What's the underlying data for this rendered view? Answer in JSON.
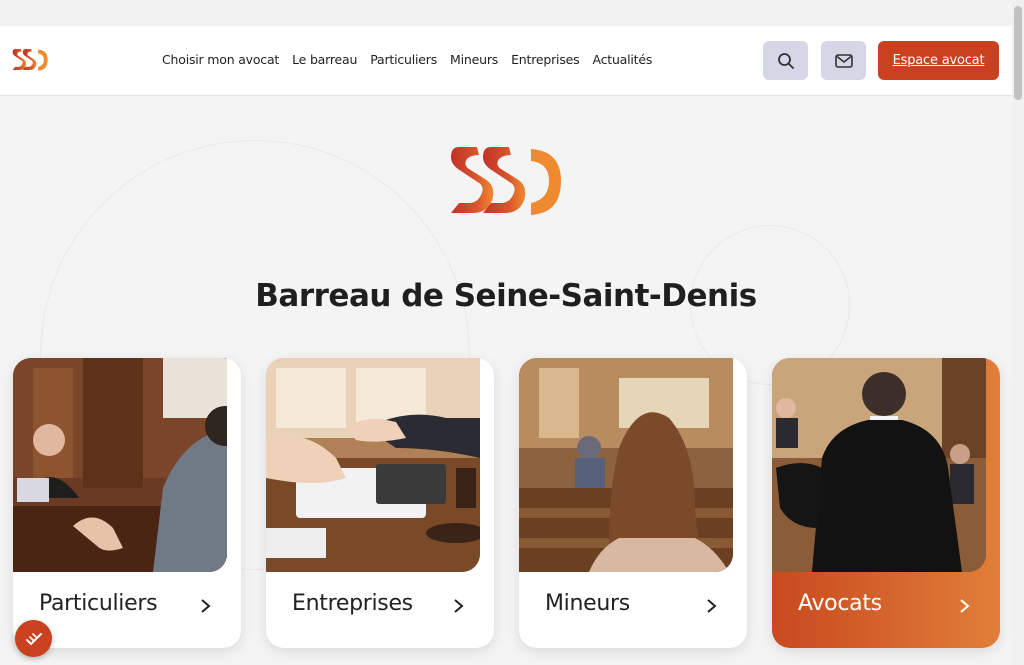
{
  "nav": {
    "items": [
      "Choisir mon avocat",
      "Le barreau",
      "Particuliers",
      "Mineurs",
      "Entreprises",
      "Actualités"
    ]
  },
  "header": {
    "espace_label": "Espace avocat",
    "search_icon": "search-icon",
    "mail_icon": "mail-icon"
  },
  "hero": {
    "title": "Barreau de Seine-Saint-Denis"
  },
  "cards": [
    {
      "label": "Particuliers"
    },
    {
      "label": "Entreprises"
    },
    {
      "label": "Mineurs"
    },
    {
      "label": "Avocats"
    }
  ],
  "colors": {
    "brand": "#c9411f",
    "brand_light": "#e07f39",
    "icon_button_bg": "#d6d7e6"
  }
}
